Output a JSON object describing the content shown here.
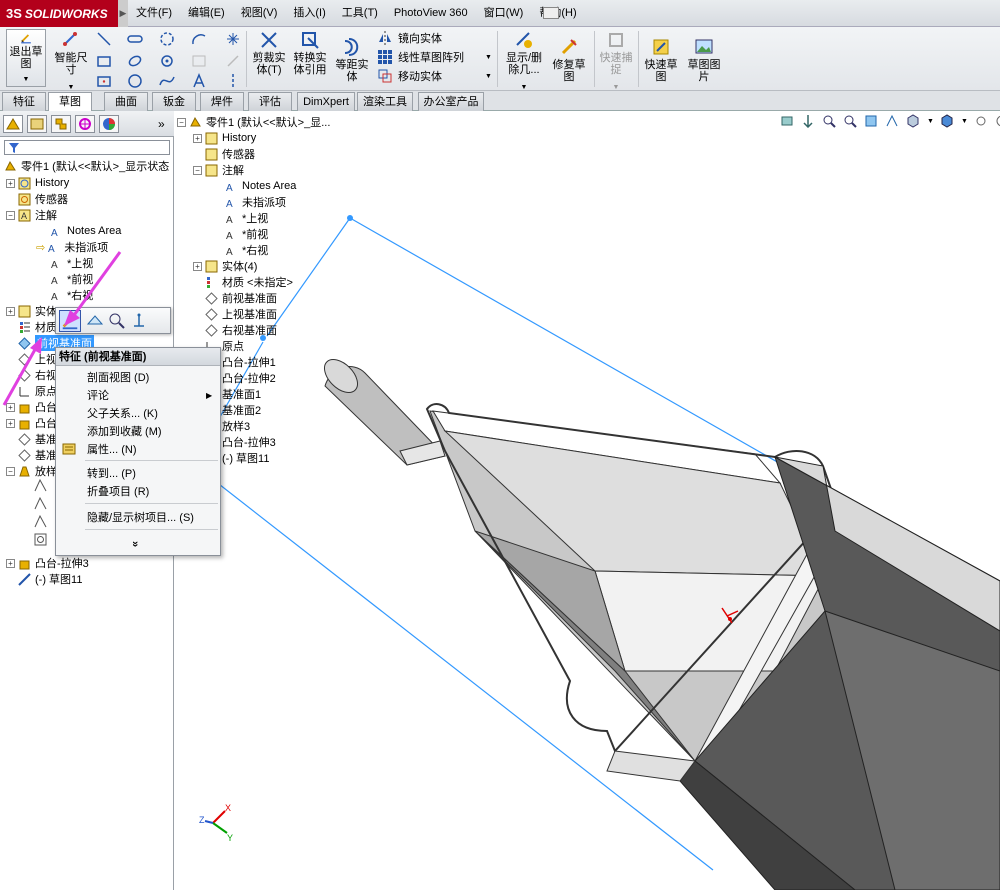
{
  "app": {
    "brand": "SOLIDWORKS",
    "menus": [
      "文件(F)",
      "编辑(E)",
      "视图(V)",
      "插入(I)",
      "工具(T)",
      "PhotoView 360",
      "窗口(W)",
      "帮助(H)"
    ]
  },
  "ribbon": {
    "exit_sketch": [
      "退出草",
      "图"
    ],
    "smart_dim": [
      "智能尺",
      "寸"
    ],
    "trim": [
      "剪裁实",
      "体(T)"
    ],
    "convert": [
      "转换实",
      "体引用"
    ],
    "offset": [
      "等距实",
      "体"
    ],
    "mirror": "镜向实体",
    "linear_pattern": "线性草图阵列",
    "move": "移动实体",
    "display_delete": [
      "显示/删",
      "除几..."
    ],
    "repair": [
      "修复草",
      "图"
    ],
    "quick_snap": [
      "快速捕",
      "捉"
    ],
    "rapid_sketch": [
      "快速草",
      "图"
    ],
    "sketch_picture": [
      "草图图",
      "片"
    ]
  },
  "tabs": [
    "特征",
    "草图",
    "曲面",
    "钣金",
    "焊件",
    "评估",
    "DimXpert",
    "渲染工具",
    "办公室产品"
  ],
  "active_tab": "草图",
  "left_tree": {
    "root": "零件1  (默认<<默认>_显示状态",
    "history": "History",
    "sensors": "传感器",
    "annotations": "注解",
    "notes_area": "Notes Area",
    "unassigned": "未指派项",
    "top_view": "*上视",
    "front_view": "*前视",
    "right_view": "*右视",
    "solid_bodies": "实体",
    "material": "材质",
    "front_plane": "前视基准面",
    "top_plane": "上视",
    "right_plane": "右视",
    "origin": "原点",
    "boss1": "凸台",
    "boss2": "凸台",
    "plane1": "基准",
    "plane2": "基准",
    "loft": "放样",
    "boss3": "凸台-拉伸3",
    "sketch11": "(-) 草图11"
  },
  "context_menu": {
    "header": "特征 (前视基准面)",
    "section_view": "剖面视图 (D)",
    "comments": "评论",
    "parent_child": "父子关系... (K)",
    "add_favorite": "添加到收藏 (M)",
    "properties": "属性... (N)",
    "go_to": "转到... (P)",
    "collapse": "折叠项目 (R)",
    "hide_show": "隐藏/显示树项目... (S)",
    "more": "»"
  },
  "flyout_tree": {
    "root": "零件1  (默认<<默认>_显...",
    "history": "History",
    "sensors": "传感器",
    "annotations": "注解",
    "notes_area": "Notes Area",
    "unassigned": "未指派项",
    "top_view": "*上视",
    "front_view": "*前视",
    "right_view": "*右视",
    "solid_bodies": "实体(4)",
    "material": "材质 <未指定>",
    "front_plane": "前视基准面",
    "top_plane": "上视基准面",
    "right_plane": "右视基准面",
    "origin": "原点",
    "boss1": "凸台-拉伸1",
    "boss2": "凸台-拉伸2",
    "plane1": "基准面1",
    "plane2": "基准面2",
    "loft": "放样3",
    "boss3": "凸台-拉伸3",
    "sketch11": "(-) 草图11"
  },
  "triad": {
    "x": "X",
    "y": "Y",
    "z": "Z"
  },
  "colors": {
    "brand_red": "#b3001b",
    "sketch_blue": "#3399ff",
    "highlight_magenta": "#e040e0"
  }
}
